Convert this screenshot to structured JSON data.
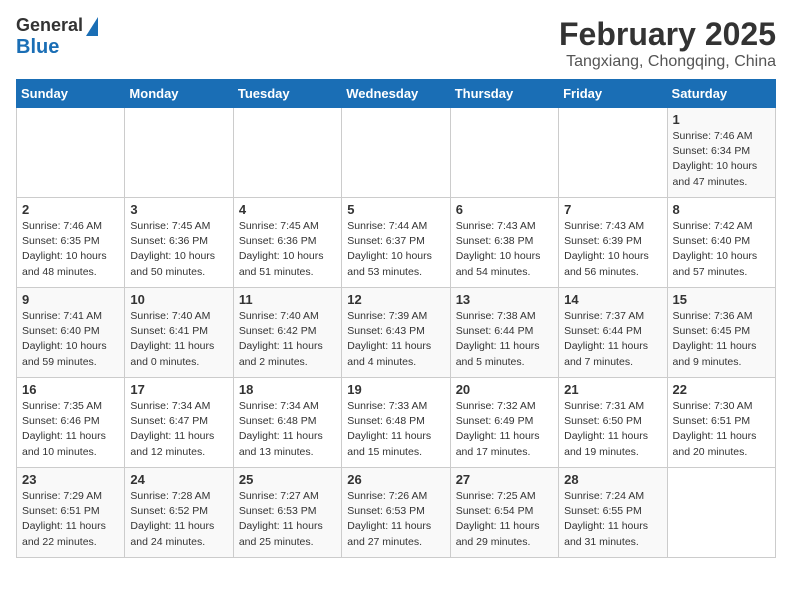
{
  "logo": {
    "line1": "General",
    "line2": "Blue"
  },
  "title": "February 2025",
  "subtitle": "Tangxiang, Chongqing, China",
  "weekdays": [
    "Sunday",
    "Monday",
    "Tuesday",
    "Wednesday",
    "Thursday",
    "Friday",
    "Saturday"
  ],
  "weeks": [
    [
      {
        "day": "",
        "info": ""
      },
      {
        "day": "",
        "info": ""
      },
      {
        "day": "",
        "info": ""
      },
      {
        "day": "",
        "info": ""
      },
      {
        "day": "",
        "info": ""
      },
      {
        "day": "",
        "info": ""
      },
      {
        "day": "1",
        "info": "Sunrise: 7:46 AM\nSunset: 6:34 PM\nDaylight: 10 hours\nand 47 minutes."
      }
    ],
    [
      {
        "day": "2",
        "info": "Sunrise: 7:46 AM\nSunset: 6:35 PM\nDaylight: 10 hours\nand 48 minutes."
      },
      {
        "day": "3",
        "info": "Sunrise: 7:45 AM\nSunset: 6:36 PM\nDaylight: 10 hours\nand 50 minutes."
      },
      {
        "day": "4",
        "info": "Sunrise: 7:45 AM\nSunset: 6:36 PM\nDaylight: 10 hours\nand 51 minutes."
      },
      {
        "day": "5",
        "info": "Sunrise: 7:44 AM\nSunset: 6:37 PM\nDaylight: 10 hours\nand 53 minutes."
      },
      {
        "day": "6",
        "info": "Sunrise: 7:43 AM\nSunset: 6:38 PM\nDaylight: 10 hours\nand 54 minutes."
      },
      {
        "day": "7",
        "info": "Sunrise: 7:43 AM\nSunset: 6:39 PM\nDaylight: 10 hours\nand 56 minutes."
      },
      {
        "day": "8",
        "info": "Sunrise: 7:42 AM\nSunset: 6:40 PM\nDaylight: 10 hours\nand 57 minutes."
      }
    ],
    [
      {
        "day": "9",
        "info": "Sunrise: 7:41 AM\nSunset: 6:40 PM\nDaylight: 10 hours\nand 59 minutes."
      },
      {
        "day": "10",
        "info": "Sunrise: 7:40 AM\nSunset: 6:41 PM\nDaylight: 11 hours\nand 0 minutes."
      },
      {
        "day": "11",
        "info": "Sunrise: 7:40 AM\nSunset: 6:42 PM\nDaylight: 11 hours\nand 2 minutes."
      },
      {
        "day": "12",
        "info": "Sunrise: 7:39 AM\nSunset: 6:43 PM\nDaylight: 11 hours\nand 4 minutes."
      },
      {
        "day": "13",
        "info": "Sunrise: 7:38 AM\nSunset: 6:44 PM\nDaylight: 11 hours\nand 5 minutes."
      },
      {
        "day": "14",
        "info": "Sunrise: 7:37 AM\nSunset: 6:44 PM\nDaylight: 11 hours\nand 7 minutes."
      },
      {
        "day": "15",
        "info": "Sunrise: 7:36 AM\nSunset: 6:45 PM\nDaylight: 11 hours\nand 9 minutes."
      }
    ],
    [
      {
        "day": "16",
        "info": "Sunrise: 7:35 AM\nSunset: 6:46 PM\nDaylight: 11 hours\nand 10 minutes."
      },
      {
        "day": "17",
        "info": "Sunrise: 7:34 AM\nSunset: 6:47 PM\nDaylight: 11 hours\nand 12 minutes."
      },
      {
        "day": "18",
        "info": "Sunrise: 7:34 AM\nSunset: 6:48 PM\nDaylight: 11 hours\nand 13 minutes."
      },
      {
        "day": "19",
        "info": "Sunrise: 7:33 AM\nSunset: 6:48 PM\nDaylight: 11 hours\nand 15 minutes."
      },
      {
        "day": "20",
        "info": "Sunrise: 7:32 AM\nSunset: 6:49 PM\nDaylight: 11 hours\nand 17 minutes."
      },
      {
        "day": "21",
        "info": "Sunrise: 7:31 AM\nSunset: 6:50 PM\nDaylight: 11 hours\nand 19 minutes."
      },
      {
        "day": "22",
        "info": "Sunrise: 7:30 AM\nSunset: 6:51 PM\nDaylight: 11 hours\nand 20 minutes."
      }
    ],
    [
      {
        "day": "23",
        "info": "Sunrise: 7:29 AM\nSunset: 6:51 PM\nDaylight: 11 hours\nand 22 minutes."
      },
      {
        "day": "24",
        "info": "Sunrise: 7:28 AM\nSunset: 6:52 PM\nDaylight: 11 hours\nand 24 minutes."
      },
      {
        "day": "25",
        "info": "Sunrise: 7:27 AM\nSunset: 6:53 PM\nDaylight: 11 hours\nand 25 minutes."
      },
      {
        "day": "26",
        "info": "Sunrise: 7:26 AM\nSunset: 6:53 PM\nDaylight: 11 hours\nand 27 minutes."
      },
      {
        "day": "27",
        "info": "Sunrise: 7:25 AM\nSunset: 6:54 PM\nDaylight: 11 hours\nand 29 minutes."
      },
      {
        "day": "28",
        "info": "Sunrise: 7:24 AM\nSunset: 6:55 PM\nDaylight: 11 hours\nand 31 minutes."
      },
      {
        "day": "",
        "info": ""
      }
    ]
  ]
}
